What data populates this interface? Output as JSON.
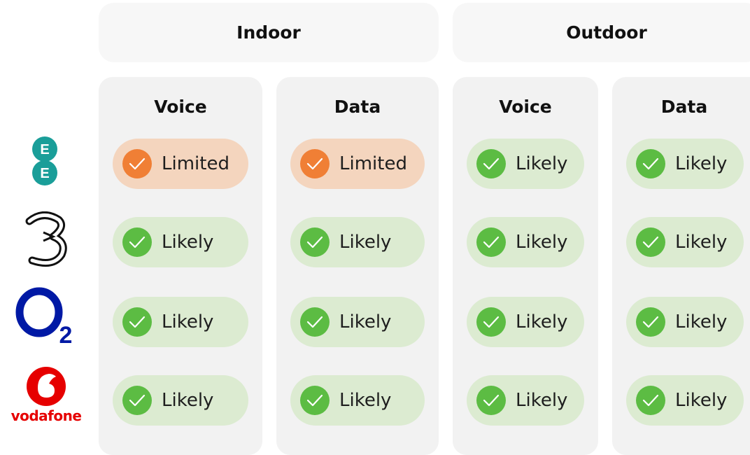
{
  "groups": [
    {
      "label": "Indoor"
    },
    {
      "label": "Outdoor"
    }
  ],
  "columns": [
    {
      "label": "Voice"
    },
    {
      "label": "Data"
    },
    {
      "label": "Voice"
    },
    {
      "label": "Data"
    }
  ],
  "operators": [
    {
      "name": "EE",
      "logo_icon": "ee-logo-icon",
      "brand_color": "#1a9e99",
      "status": [
        "Limited",
        "Limited",
        "Likely",
        "Likely"
      ]
    },
    {
      "name": "Three",
      "logo_icon": "three-logo-icon",
      "brand_color": "#111111",
      "status": [
        "Likely",
        "Likely",
        "Likely",
        "Likely"
      ]
    },
    {
      "name": "O2",
      "logo_icon": "o2-logo-icon",
      "brand_color": "#0019a5",
      "status": [
        "Likely",
        "Likely",
        "Likely",
        "Likely"
      ]
    },
    {
      "name": "Vodafone",
      "logo_icon": "vodafone-logo-icon",
      "brand_color": "#e60000",
      "wordmark": "vodafone",
      "status": [
        "Likely",
        "Likely",
        "Likely",
        "Likely"
      ]
    }
  ],
  "colors": {
    "likely_bg": "#dcebd1",
    "likely_icon": "#5cbc43",
    "limited_bg": "#f4d5be",
    "limited_icon": "#f07f35"
  }
}
